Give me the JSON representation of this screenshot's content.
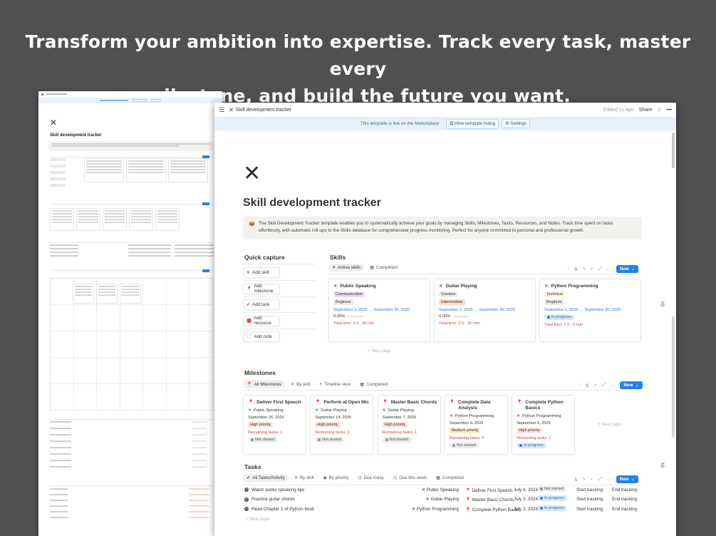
{
  "headline": {
    "line1": "Transform your ambition into expertise. Track every task, master every",
    "line2": "milestone, and build the future you want."
  },
  "window": {
    "page_title": "Skill development tracker",
    "edited": "Edited 1y ago",
    "share": "Share",
    "more": "•••",
    "star": "☆"
  },
  "banner": {
    "text": "This template is live on the Marketplace",
    "view": "View template listing",
    "settings": "Settings"
  },
  "page": {
    "title": "Skill development tracker",
    "callout": "The Skill Development Tracker template enables you to systematically achieve your goals by managing Skills, Milestones, Tasks, Resources, and Notes. Track time spent on tasks effortlessly, with automatic roll-ups to the Skills database for comprehensive progress monitoring. Perfect for anyone committed to personal and professional growth."
  },
  "quick_capture": {
    "title": "Quick capture",
    "buttons": [
      {
        "icon": "✕",
        "label": "Add skill"
      },
      {
        "icon": "📍",
        "label": "Add milestone"
      },
      {
        "icon": "✔",
        "label": "Add task"
      },
      {
        "icon": "📕",
        "label": "Add resource"
      },
      {
        "icon": "📄",
        "label": "Add note"
      }
    ]
  },
  "skills": {
    "title": "Skills",
    "tabs": [
      "Active skills",
      "Completed"
    ],
    "new": "New",
    "new_page": "+ New page",
    "cards": [
      {
        "name": "Public Speaking",
        "tag": "Communication",
        "tag_color": "#e8deee",
        "level": "Beginner",
        "level_color": "#ececeb",
        "dates": "September 1, 2025 → September 30, 2025",
        "pct": "0.00%",
        "time": "Total time: 1 h : 30 min"
      },
      {
        "name": "Guitar Playing",
        "tag": "Creative",
        "tag_color": "#ececeb",
        "level": "Intermediate",
        "level_color": "#fadec9",
        "dates": "September 1, 2025 → September 30, 2025",
        "pct": "0.00%",
        "time": "Total time: 2 h : 30 min"
      },
      {
        "name": "Python Programming",
        "tag": "Technical",
        "tag_color": "#fbf3db",
        "level": "Beginner",
        "level_color": "#ececeb",
        "dates": "September 1, 2025 → September 30, 2025",
        "status": "In progress",
        "time": "Total time: 2 h : 0 min"
      }
    ]
  },
  "milestones": {
    "title": "Milestones",
    "tabs": [
      "All Milestones",
      "By skill",
      "Timeline view",
      "Completed"
    ],
    "new": "New",
    "new_page": "+ New page",
    "cards": [
      {
        "name": "Deliver First Speech",
        "skill": "Public Speaking",
        "date": "September 26, 2025",
        "priority": "High priority",
        "pcolor": "#ffe2dd",
        "remaining": "Remaining tasks: 1",
        "status": "Not started"
      },
      {
        "name": "Perform at Open Mic",
        "skill": "Guitar Playing",
        "date": "September 14, 2025",
        "priority": "High priority",
        "pcolor": "#ffe2dd",
        "remaining": "Remaining tasks: 0",
        "status": "Not started"
      },
      {
        "name": "Master Basic Chords",
        "skill": "Guitar Playing",
        "date": "September 7, 2025",
        "priority": "High priority",
        "pcolor": "#ffe2dd",
        "remaining": "Remaining tasks: 1",
        "status": "Not started"
      },
      {
        "name": "Complete Data Analysis",
        "skill": "Python Programming",
        "date": "September 9, 2025",
        "priority": "Medium priority",
        "pcolor": "#fdecc8",
        "remaining": "Remaining tasks: 0",
        "status": "Not started"
      },
      {
        "name": "Complete Python Basics",
        "skill": "Python Programming",
        "date": "September 6, 2025",
        "priority": "High priority",
        "pcolor": "#ffe2dd",
        "remaining": "Remaining tasks: 1",
        "status": "In progress"
      }
    ]
  },
  "tasks": {
    "title": "Tasks",
    "tabs": [
      "All Tasks/Activity",
      "By skill",
      "By priority",
      "Due today",
      "Due this week",
      "Completed"
    ],
    "new": "New",
    "new_page": "+ New page",
    "rows": [
      {
        "name": "Watch public speaking tips",
        "skill": "Public Speaking",
        "milestone": "Deliver First Speech",
        "date": "July 4, 2024",
        "status": "Not started",
        "start": "Start tracking",
        "end": "End tracking"
      },
      {
        "name": "Practice guitar chords",
        "skill": "Guitar Playing",
        "milestone": "Master Basic Chords",
        "date": "July 3, 2024",
        "status": "In progress",
        "start": "Start tracking",
        "end": "End tracking"
      },
      {
        "name": "Read Chapter 1 of Python book",
        "skill": "Python Programming",
        "milestone": "Complete Python Basici",
        "date": "July 2, 2024",
        "status": "In progress",
        "start": "Start tracking",
        "end": "End tracking"
      }
    ]
  },
  "colors": {
    "accent": "#2383e2",
    "background": "#505050",
    "red_text": "#e03e3e"
  }
}
